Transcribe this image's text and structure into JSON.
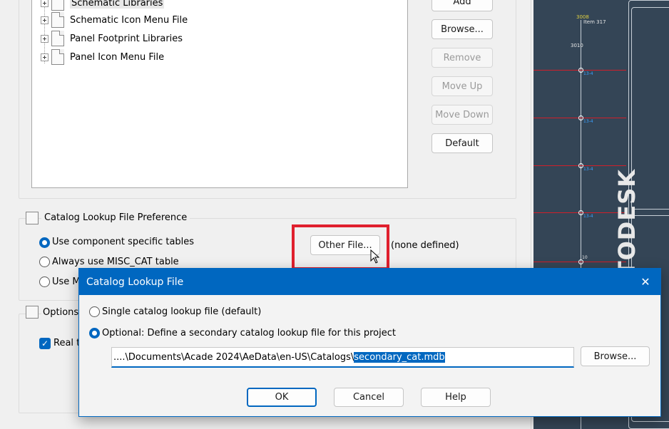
{
  "library_tree": {
    "items": [
      {
        "label": "Schematic Libraries"
      },
      {
        "label": "Schematic Icon Menu File"
      },
      {
        "label": "Panel Footprint Libraries"
      },
      {
        "label": "Panel Icon Menu File"
      }
    ]
  },
  "side_buttons": {
    "add": "Add",
    "browse": "Browse...",
    "remove": "Remove",
    "move_up": "Move Up",
    "move_down": "Move Down",
    "default": "Default"
  },
  "catalog_pref": {
    "title": "Catalog Lookup File Preference",
    "options": [
      "Use component specific tables",
      "Always use MISC_CAT table",
      "Use M"
    ],
    "selected_index": 0,
    "other_file_button": "Other File...",
    "status": "(none defined)"
  },
  "options_group": {
    "title": "Options",
    "checkbox_label": "Real t",
    "checked": true
  },
  "dialog": {
    "title": "Catalog Lookup File",
    "close_glyph": "✕",
    "radio_single": "Single catalog lookup file (default)",
    "radio_optional": "Optional: Define a secondary catalog lookup file for this project",
    "selected": "optional",
    "path_prefix": "....\\Documents\\Acade 2024\\AeData\\en-US\\Catalogs\\",
    "path_selected": "secondary_cat.mdb",
    "browse": "Browse...",
    "ok": "OK",
    "cancel": "Cancel",
    "help": "Help"
  },
  "cad": {
    "top_label_a": "3008",
    "top_label_b": "Item 317",
    "label_c": "3010",
    "wire_tag": "13-4",
    "bottom_label": "10",
    "vertical_text": "AUTODESK"
  },
  "colors": {
    "accent": "#0067c0",
    "highlight_box": "#e0202e",
    "cad_background": "#344556",
    "cad_wire": "#d01f2a"
  },
  "icons": [
    "tree-expand-icon",
    "library-folder-icon",
    "document-icon",
    "group-settings-icon",
    "mouse-cursor-icon",
    "close-icon",
    "red-arrow-annotation"
  ]
}
